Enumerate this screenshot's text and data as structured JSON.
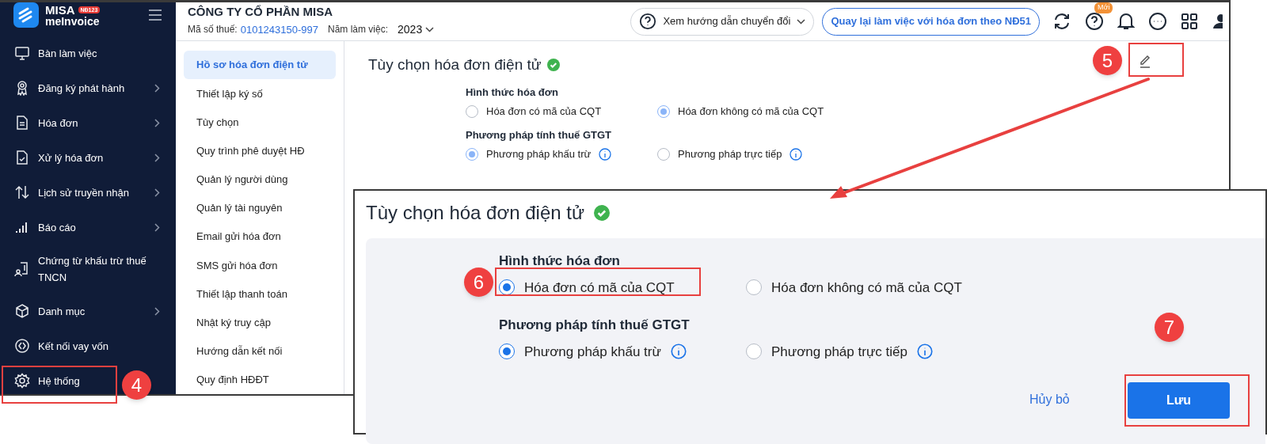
{
  "sidebar": {
    "logo": {
      "line1": "MISA",
      "line2": "meInvoice",
      "badge": "NĐ123"
    },
    "items": [
      {
        "kind": "link",
        "label": "Bàn làm việc"
      },
      {
        "kind": "group",
        "label": "Đăng ký phát hành"
      },
      {
        "kind": "group",
        "label": "Hóa đơn"
      },
      {
        "kind": "group",
        "label": "Xử lý hóa đơn"
      },
      {
        "kind": "group",
        "label": "Lịch sử truyền nhận"
      },
      {
        "kind": "group",
        "label": "Báo cáo"
      },
      {
        "kind": "link",
        "label": "Chứng từ khấu trừ thuế TNCN"
      },
      {
        "kind": "group",
        "label": "Danh mục"
      },
      {
        "kind": "link",
        "label": "Kết nối vay vốn"
      },
      {
        "kind": "link",
        "label": "Hệ thống"
      }
    ]
  },
  "header": {
    "company": "CÔNG TY CỔ PHẦN MISA",
    "tax_label": "Mã số thuế:",
    "tax_value": "0101243150-997",
    "year_label": "Năm làm việc:",
    "year": "2023",
    "guide_button": "Xem hướng dẫn chuyển đổi",
    "back_button": "Quay lại làm việc với hóa đơn theo NĐ51",
    "new_badge": "Mới"
  },
  "submenu": [
    {
      "label": "Hồ sơ hóa đơn điện tử",
      "selected": true
    },
    {
      "label": "Thiết lập ký số",
      "selected": false
    },
    {
      "label": "Tùy chọn",
      "selected": false
    },
    {
      "label": "Quy trình phê duyệt HĐ",
      "selected": false
    },
    {
      "label": "Quản lý người dùng",
      "selected": false
    },
    {
      "label": "Quản lý tài nguyên",
      "selected": false
    },
    {
      "label": "Email gửi hóa đơn",
      "selected": false
    },
    {
      "label": "SMS gửi hóa đơn",
      "selected": false
    },
    {
      "label": "Thiết lập thanh toán",
      "selected": false
    },
    {
      "label": "Nhật ký truy cập",
      "selected": false
    },
    {
      "label": "Hướng dẫn kết nối",
      "selected": false
    },
    {
      "label": "Quy định HĐĐT",
      "selected": false
    }
  ],
  "panel": {
    "title": "Tùy chọn hóa đơn điện tử",
    "groups": [
      {
        "label": "Hình thức hóa đơn",
        "options": [
          {
            "kind": "plain",
            "label": "Hóa đơn có mã của CQT",
            "selected": false
          },
          {
            "kind": "plain",
            "label": "Hóa đơn không có mã của CQT",
            "selected": true
          }
        ]
      },
      {
        "label": "Phương pháp tính thuế GTGT",
        "options": [
          {
            "kind": "info",
            "label": "Phương pháp khấu trừ",
            "selected": true
          },
          {
            "kind": "info",
            "label": "Phương pháp trực tiếp",
            "selected": false
          }
        ]
      }
    ]
  },
  "edit_panel": {
    "title": "Tùy chọn hóa đơn điện tử",
    "groups": [
      {
        "label": "Hình thức hóa đơn",
        "options": [
          {
            "kind": "plain",
            "label": "Hóa đơn có mã của CQT",
            "selected": true
          },
          {
            "kind": "plain",
            "label": "Hóa đơn không có mã của CQT",
            "selected": false
          }
        ]
      },
      {
        "label": "Phương pháp tính thuế GTGT",
        "options": [
          {
            "kind": "info",
            "label": "Phương pháp khấu trừ",
            "selected": true
          },
          {
            "kind": "info",
            "label": "Phương pháp trực tiếp",
            "selected": false
          }
        ]
      }
    ],
    "cancel": "Hủy bỏ",
    "save": "Lưu"
  },
  "annotations": [
    {
      "number": "4"
    },
    {
      "number": "5"
    },
    {
      "number": "6"
    },
    {
      "number": "7"
    }
  ]
}
